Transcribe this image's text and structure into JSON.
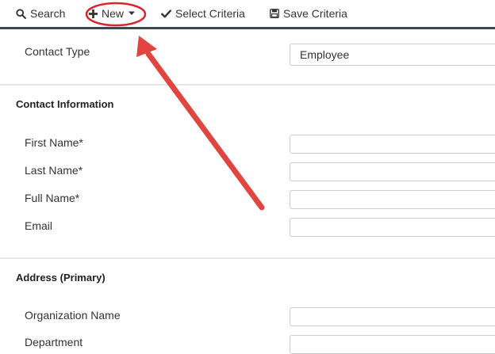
{
  "toolbar": {
    "search_label": "Search",
    "new_label": "New",
    "select_criteria_label": "Select Criteria",
    "save_criteria_label": "Save Criteria"
  },
  "contact_type": {
    "label": "Contact Type",
    "value": "Employee"
  },
  "contact_information": {
    "title": "Contact Information",
    "first_name_label": "First Name*",
    "first_name_value": "",
    "last_name_label": "Last Name*",
    "last_name_value": "",
    "full_name_label": "Full Name*",
    "full_name_value": "",
    "email_label": "Email",
    "email_value": ""
  },
  "address_primary": {
    "title": "Address (Primary)",
    "organization_name_label": "Organization Name",
    "organization_name_value": "",
    "department_label": "Department"
  },
  "annotation": {
    "highlight_color": "#d9262c",
    "arrow_color": "#e0463f"
  },
  "colors": {
    "toolbar_rule": "#3d4750",
    "divider": "#e6e6e6",
    "field_border": "#cccccc"
  }
}
